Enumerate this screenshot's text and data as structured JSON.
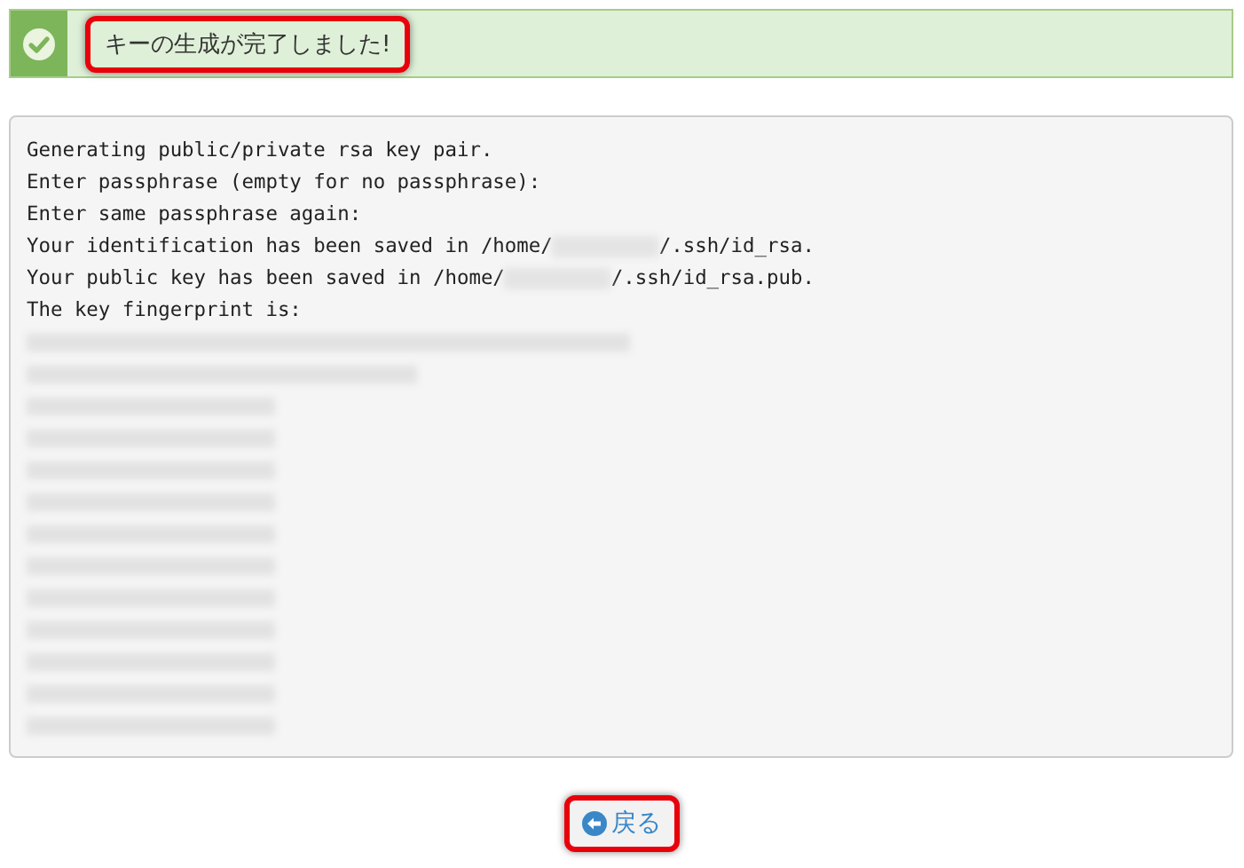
{
  "alert": {
    "message": "キーの生成が完了しました!",
    "highlighted": true
  },
  "output": {
    "lines": [
      {
        "kind": "text",
        "text": "Generating public/private rsa key pair."
      },
      {
        "kind": "text",
        "text": "Enter passphrase (empty for no passphrase):"
      },
      {
        "kind": "text",
        "text": "Enter same passphrase again:"
      },
      {
        "kind": "redacted_path",
        "before": "Your identification has been saved in /home/",
        "after": "/.ssh/id_rsa."
      },
      {
        "kind": "redacted_path",
        "before": "Your public key has been saved in /home/",
        "after": "/.ssh/id_rsa.pub."
      },
      {
        "kind": "text",
        "text": "The key fingerprint is:"
      },
      {
        "kind": "blurred"
      },
      {
        "kind": "blurred"
      },
      {
        "kind": "blurred"
      },
      {
        "kind": "blurred"
      },
      {
        "kind": "blurred"
      },
      {
        "kind": "blurred"
      },
      {
        "kind": "blurred"
      },
      {
        "kind": "blurred"
      },
      {
        "kind": "blurred"
      },
      {
        "kind": "blurred"
      },
      {
        "kind": "blurred"
      },
      {
        "kind": "blurred"
      },
      {
        "kind": "blurred"
      }
    ]
  },
  "back_button": {
    "label": "戻る",
    "highlighted": true
  }
}
